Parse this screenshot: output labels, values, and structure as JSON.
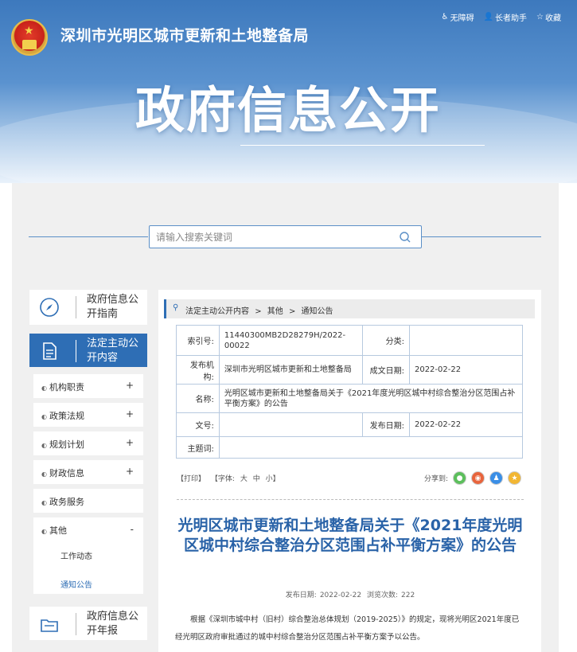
{
  "header": {
    "site_title": "深圳市光明区城市更新和土地整备局",
    "top_links": [
      "无障碍",
      "长者助手",
      "收藏"
    ],
    "big_title": "政府信息公开"
  },
  "search": {
    "placeholder": "请输入搜索关键词"
  },
  "sidebar": {
    "guide": "政府信息公开指南",
    "active": "法定主动公开内容",
    "items": [
      {
        "label": "机构职责",
        "toggle": "+"
      },
      {
        "label": "政策法规",
        "toggle": "+"
      },
      {
        "label": "规划计划",
        "toggle": "+"
      },
      {
        "label": "财政信息",
        "toggle": "+"
      },
      {
        "label": "政务服务",
        "toggle": ""
      }
    ],
    "group": {
      "label": "其他",
      "toggle": "-",
      "subs": [
        "工作动态",
        "通知公告"
      ]
    },
    "annual": "政府信息公开年报"
  },
  "breadcrumb": [
    "法定主动公开内容",
    ">",
    "其他",
    ">",
    "通知公告"
  ],
  "meta_table": {
    "index_label": "索引号:",
    "index_value": "11440300MB2D28279H/2022-00022",
    "category_label": "分类:",
    "category_value": "",
    "org_label": "发布机构:",
    "org_value": "深圳市光明区城市更新和土地整备局",
    "created_label": "成文日期:",
    "created_value": "2022-02-22",
    "name_label": "名称:",
    "name_value": "光明区城市更新和土地整备局关于《2021年度光明区城中村综合整治分区范围占补平衡方案》的公告",
    "docno_label": "文号:",
    "docno_value": "",
    "published_label": "发布日期:",
    "published_value": "2022-02-22",
    "subject_label": "主题词:",
    "subject_value": ""
  },
  "tools": {
    "print": "【打印】",
    "font": "【字体:",
    "large": "大",
    "medium": "中",
    "small": "小】",
    "share_label": "分享到:"
  },
  "article": {
    "title": "光明区城市更新和土地整备局关于《2021年度光明区城中村综合整治分区范围占补平衡方案》的公告",
    "date_label": "发布日期:",
    "date_value": "2022-02-22",
    "views_label": "浏览次数:",
    "views_value": "222",
    "body": "根据《深圳市城中村（旧村）综合整治总体规划（2019-2025）》的规定，现将光明区2021年度已经光明区政府审批通过的城中村综合整治分区范围占补平衡方案予以公告。"
  },
  "colors": {
    "primary": "#2e6eb5",
    "title_blue": "#2a63a8"
  }
}
